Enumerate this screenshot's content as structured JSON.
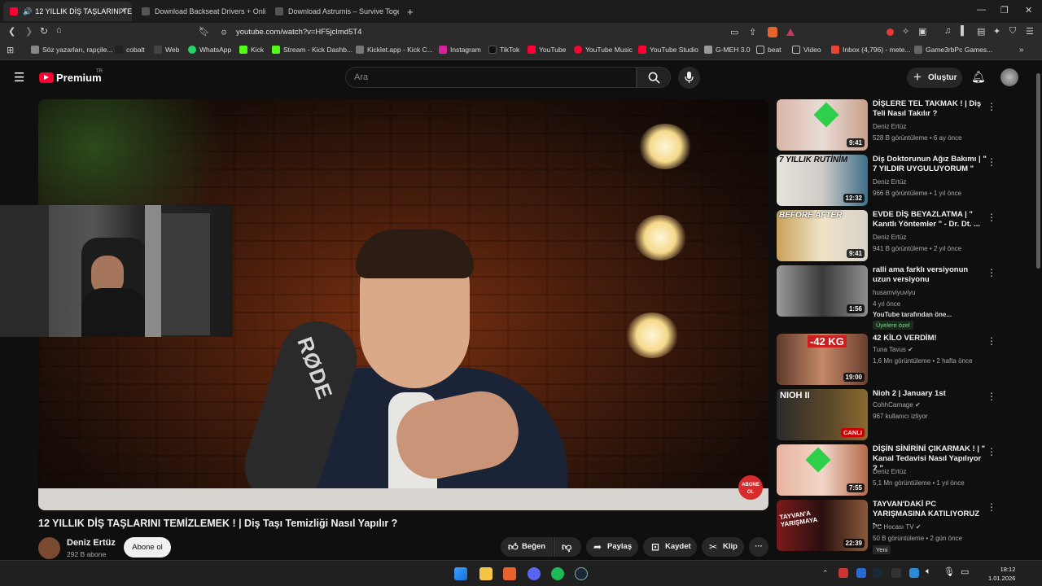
{
  "browser": {
    "tabs": [
      {
        "title": "12 YILLIK DİŞ TAŞLARINI TEMİ",
        "active": true
      },
      {
        "title": "Download Backseat Drivers + Online",
        "active": false
      },
      {
        "title": "Download Astrumis – Survive Togeth",
        "active": false
      }
    ],
    "new_tab": "+",
    "url": "youtube.com/watch?v=HF5jcImd5T4",
    "bookmarks": [
      "Söz yazarları, rapçile...",
      "cobalt",
      "Web",
      "WhatsApp",
      "Kick",
      "Stream - Kick Dashb...",
      "Kicklet.app - Kick C...",
      "Instagram",
      "TikTok",
      "YouTube",
      "YouTube Music",
      "YouTube Studio",
      "G-MEH 3.0",
      "beat",
      "Video",
      "Inbox (4,796) - mete...",
      "Game3rbPc Games..."
    ],
    "more": "»"
  },
  "youtube": {
    "logo": "Premium",
    "logo_sup": "TR",
    "search_placeholder": "Ara",
    "create_label": "Oluştur"
  },
  "video": {
    "title": "12 YILLIK DİŞ TAŞLARINI TEMİZLEMEK ! | Diş Taşı Temizliği Nasıl Yapılır ?",
    "channel": "Deniz Ertüz",
    "subscribers": "292 B abone",
    "subscribe_label": "Abone ol",
    "like_label": "Beğen",
    "share_label": "Paylaş",
    "save_label": "Kaydet",
    "clip_label": "Klip",
    "mic_brand": "RØDE",
    "watermark": "ABONE OL",
    "progress": 0.0
  },
  "related": [
    {
      "title": "DİŞLERE TEL TAKMAK ! | Diş Teli Nasıl Takılır ?",
      "channel": "Deniz Ertüz",
      "meta": "528 B görüntüleme • 6 ay önce",
      "duration": "9:41",
      "thumb_text": ""
    },
    {
      "title": "Diş Doktorunun Ağız Bakımı | \" 7 YILDIR UYGULUYORUM \"",
      "channel": "Deniz Ertüz",
      "meta": "966 B görüntüleme • 1 yıl önce",
      "duration": "12:32",
      "thumb_text": "7 YILLIK RUTİNİM"
    },
    {
      "title": "EVDE DİŞ BEYAZLATMA | \" Kanıtlı Yöntemler \" - Dr. Dt. ...",
      "channel": "Deniz Ertüz",
      "meta": "941 B görüntüleme • 2 yıl önce",
      "duration": "9:41",
      "thumb_text": "BEFORE AFTER"
    },
    {
      "title": "ralli ama farklı versiyonun uzun versiyonu",
      "channel": "husamviyuviyu",
      "meta": "4 yıl önce",
      "extra": "YouTube tarafından öne...",
      "badge": "Üyelere özel",
      "duration": "1:56",
      "thumb_text": ""
    },
    {
      "title": "42 KİLO VERDİM!",
      "channel": "Tuna Tavus",
      "meta": "1,6 Mn görüntüleme • 2 hafta önce",
      "duration": "19:00",
      "thumb_text": "-42 KG"
    },
    {
      "title": "Nioh 2 | January 1st",
      "channel": "CohhCarnage",
      "meta": "967 kullanıcı izliyor",
      "duration": "CANLI",
      "thumb_text": "NIOH II"
    },
    {
      "title": "DİŞİN SİNİRİNİ ÇIKARMAK ! | \" Kanal Tedavisi Nasıl Yapılıyor ? \"",
      "channel": "Deniz Ertüz",
      "meta": "5,1 Mn görüntüleme • 1 yıl önce",
      "duration": "7:55",
      "thumb_text": ""
    },
    {
      "title": "TAYVAN'DAKİ PC YARIŞMASINA KATILIYORUZ -...",
      "channel": "PC Hocası TV",
      "meta": "50 B görüntüleme • 2 gün önce",
      "badge2": "Yeni",
      "duration": "22:39",
      "thumb_text": "TAYVAN'A YARIŞMAYA"
    }
  ],
  "taskbar": {
    "time": "18:12",
    "date": "1.01.2026"
  }
}
